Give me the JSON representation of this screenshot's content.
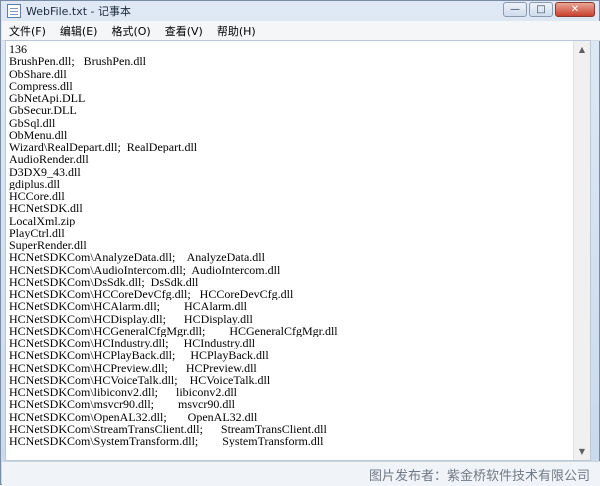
{
  "window": {
    "title": "WebFile.txt - 记事本"
  },
  "caption": {
    "minimize": "—",
    "maximize": "□",
    "close": "✕"
  },
  "menu": [
    "文件(F)",
    "编辑(E)",
    "格式(O)",
    "查看(V)",
    "帮助(H)"
  ],
  "lines": [
    "136",
    "BrushPen.dll;   BrushPen.dll",
    "ObShare.dll",
    "Compress.dll",
    "GbNetApi.DLL",
    "GbSecur.DLL",
    "GbSql.dll",
    "ObMenu.dll",
    "Wizard\\RealDepart.dll;  RealDepart.dll",
    "AudioRender.dll",
    "D3DX9_43.dll",
    "gdiplus.dll",
    "HCCore.dll",
    "HCNetSDK.dll",
    "LocalXml.zip",
    "PlayCtrl.dll",
    "SuperRender.dll",
    "HCNetSDKCom\\AnalyzeData.dll;    AnalyzeData.dll",
    "HCNetSDKCom\\AudioIntercom.dll;  AudioIntercom.dll",
    "HCNetSDKCom\\DsSdk.dll;  DsSdk.dll",
    "HCNetSDKCom\\HCCoreDevCfg.dll;   HCCoreDevCfg.dll",
    "HCNetSDKCom\\HCAlarm.dll;        HCAlarm.dll",
    "HCNetSDKCom\\HCDisplay.dll;      HCDisplay.dll",
    "HCNetSDKCom\\HCGeneralCfgMgr.dll;        HCGeneralCfgMgr.dll",
    "HCNetSDKCom\\HCIndustry.dll;     HCIndustry.dll",
    "HCNetSDKCom\\HCPlayBack.dll;     HCPlayBack.dll",
    "HCNetSDKCom\\HCPreview.dll;      HCPreview.dll",
    "HCNetSDKCom\\HCVoiceTalk.dll;    HCVoiceTalk.dll",
    "HCNetSDKCom\\libiconv2.dll;      libiconv2.dll",
    "HCNetSDKCom\\msvcr90.dll;        msvcr90.dll",
    "HCNetSDKCom\\OpenAL32.dll;       OpenAL32.dll",
    "HCNetSDKCom\\StreamTransClient.dll;      StreamTransClient.dll",
    "HCNetSDKCom\\SystemTransform.dll;        SystemTransform.dll"
  ],
  "watermark": "图片发布者：紫金桥软件技术有限公司"
}
